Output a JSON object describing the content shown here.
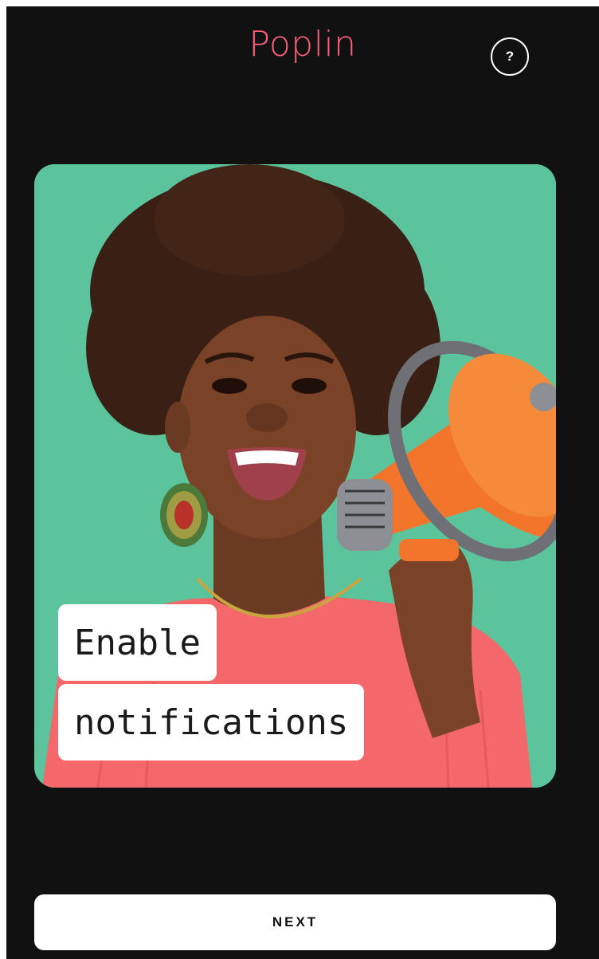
{
  "header": {
    "logo_text": "Poplin",
    "help_label": "?"
  },
  "hero": {
    "caption_line_1": "Enable",
    "caption_line_2": "notifications"
  },
  "footer": {
    "next_label": "NEXT"
  },
  "colors": {
    "background": "#111111",
    "brand": "#ff5f7a",
    "hero_background": "#5fc9a0",
    "button_background": "#ffffff"
  }
}
